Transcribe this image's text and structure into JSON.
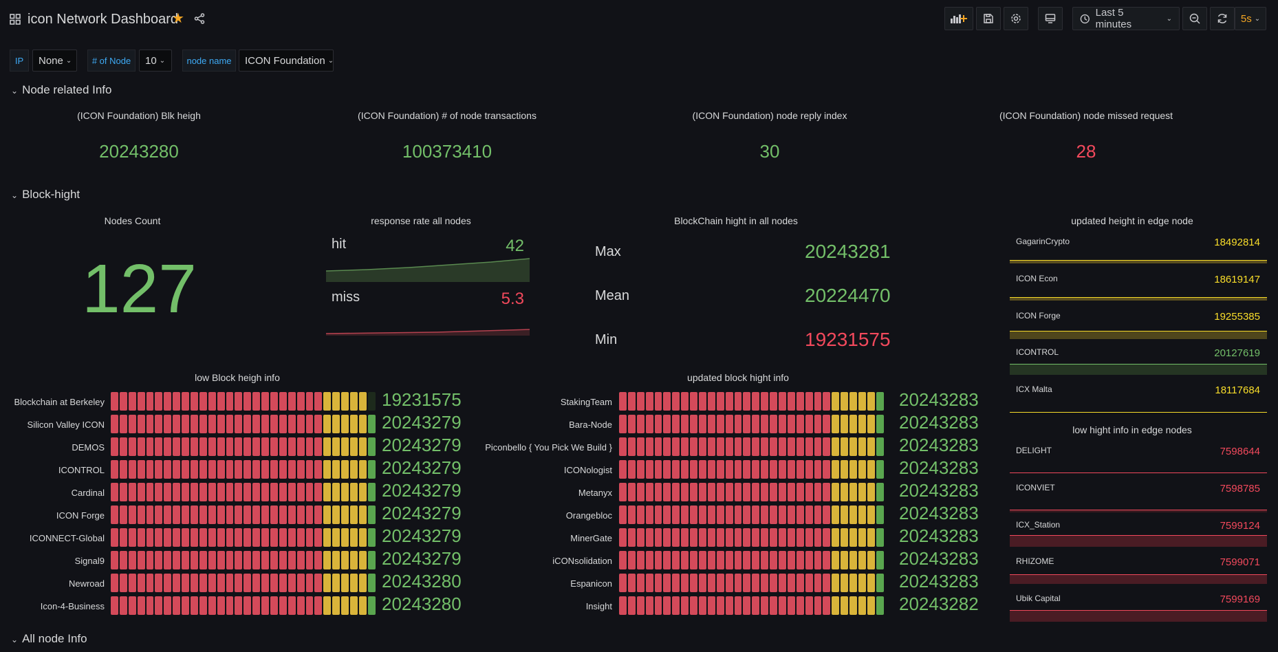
{
  "header": {
    "title": "icon Network Dashboard",
    "time_range": "Last 5 minutes",
    "refresh_interval": "5s",
    "icons": [
      "apps-icon",
      "star-icon",
      "share-icon",
      "add-panel-icon",
      "save-icon",
      "settings-icon",
      "tv-icon",
      "clock-icon",
      "zoom-out-icon",
      "refresh-icon"
    ]
  },
  "variables": [
    {
      "label": "IP",
      "value": "None"
    },
    {
      "label": "# of Node",
      "value": "10"
    },
    {
      "label": "node name",
      "value": "ICON Foundation"
    }
  ],
  "rows": {
    "node_info": "Node related Info",
    "block_hight": "Block-hight",
    "all_node": "All node Info"
  },
  "node_stats": [
    {
      "title": "(ICON Foundation) Blk heigh",
      "value": "20243280",
      "color": "#73bf69"
    },
    {
      "title": "(ICON Foundation) # of node transactions",
      "value": "100373410",
      "color": "#73bf69"
    },
    {
      "title": "(ICON Foundation) node reply index",
      "value": "30",
      "color": "#73bf69"
    },
    {
      "title": "(ICON Foundation) node missed request",
      "value": "28",
      "color": "#f2495c"
    }
  ],
  "nodes_count": {
    "title": "Nodes Count",
    "value": "127"
  },
  "response_rate": {
    "title": "response rate all nodes",
    "hit": {
      "label": "hit",
      "value": "42"
    },
    "miss": {
      "label": "miss",
      "value": "5.3"
    }
  },
  "blockchain_hight": {
    "title": "BlockChain hight in all nodes",
    "rows": [
      {
        "label": "Max",
        "value": "20243281",
        "color": "#73bf69"
      },
      {
        "label": "Mean",
        "value": "20224470",
        "color": "#73bf69"
      },
      {
        "label": "Min",
        "value": "19231575",
        "color": "#f2495c"
      }
    ]
  },
  "low_block": {
    "title": "low Block heigh info",
    "items": [
      {
        "name": "Blockchain at Berkeley",
        "value": "19231575"
      },
      {
        "name": "Silicon Valley ICON",
        "value": "20243279"
      },
      {
        "name": "DEMOS",
        "value": "20243279"
      },
      {
        "name": "ICONTROL",
        "value": "20243279"
      },
      {
        "name": "Cardinal",
        "value": "20243279"
      },
      {
        "name": "ICON Forge",
        "value": "20243279"
      },
      {
        "name": "ICONNECT-Global",
        "value": "20243279"
      },
      {
        "name": "Signal9",
        "value": "20243279"
      },
      {
        "name": "Newroad",
        "value": "20243280"
      },
      {
        "name": "Icon-4-Business",
        "value": "20243280"
      }
    ]
  },
  "updated_block": {
    "title": "updated block hight info",
    "items": [
      {
        "name": "StakingTeam",
        "value": "20243283"
      },
      {
        "name": "Bara-Node",
        "value": "20243283"
      },
      {
        "name": "Piconbello { You Pick We Build }",
        "value": "20243283"
      },
      {
        "name": "ICONologist",
        "value": "20243283"
      },
      {
        "name": "Metanyx",
        "value": "20243283"
      },
      {
        "name": "Orangebloc",
        "value": "20243283"
      },
      {
        "name": "MinerGate",
        "value": "20243283"
      },
      {
        "name": "iCONsolidation",
        "value": "20243283"
      },
      {
        "name": "Espanicon",
        "value": "20243283"
      },
      {
        "name": "Insight",
        "value": "20243282"
      }
    ]
  },
  "edge_updated": {
    "title": "updated height in edge node",
    "items": [
      {
        "name": "GagarinCrypto",
        "value": "18492814",
        "color": "#fade2a"
      },
      {
        "name": "ICON Econ",
        "value": "18619147",
        "color": "#fade2a"
      },
      {
        "name": "ICON Forge",
        "value": "19255385",
        "color": "#fade2a"
      },
      {
        "name": "ICONTROL",
        "value": "20127619",
        "color": "#73bf69"
      },
      {
        "name": "ICX Malta",
        "value": "18117684",
        "color": "#fade2a"
      }
    ]
  },
  "edge_low": {
    "title": "low hight info in edge nodes",
    "items": [
      {
        "name": "DELIGHT",
        "value": "7598644",
        "color": "#f2495c"
      },
      {
        "name": "ICONVIET",
        "value": "7598785",
        "color": "#f2495c"
      },
      {
        "name": "ICX_Station",
        "value": "7599124",
        "color": "#f2495c"
      },
      {
        "name": "RHIZOME",
        "value": "7599071",
        "color": "#f2495c"
      },
      {
        "name": "Ubik Capital",
        "value": "7599169",
        "color": "#f2495c"
      }
    ]
  }
}
